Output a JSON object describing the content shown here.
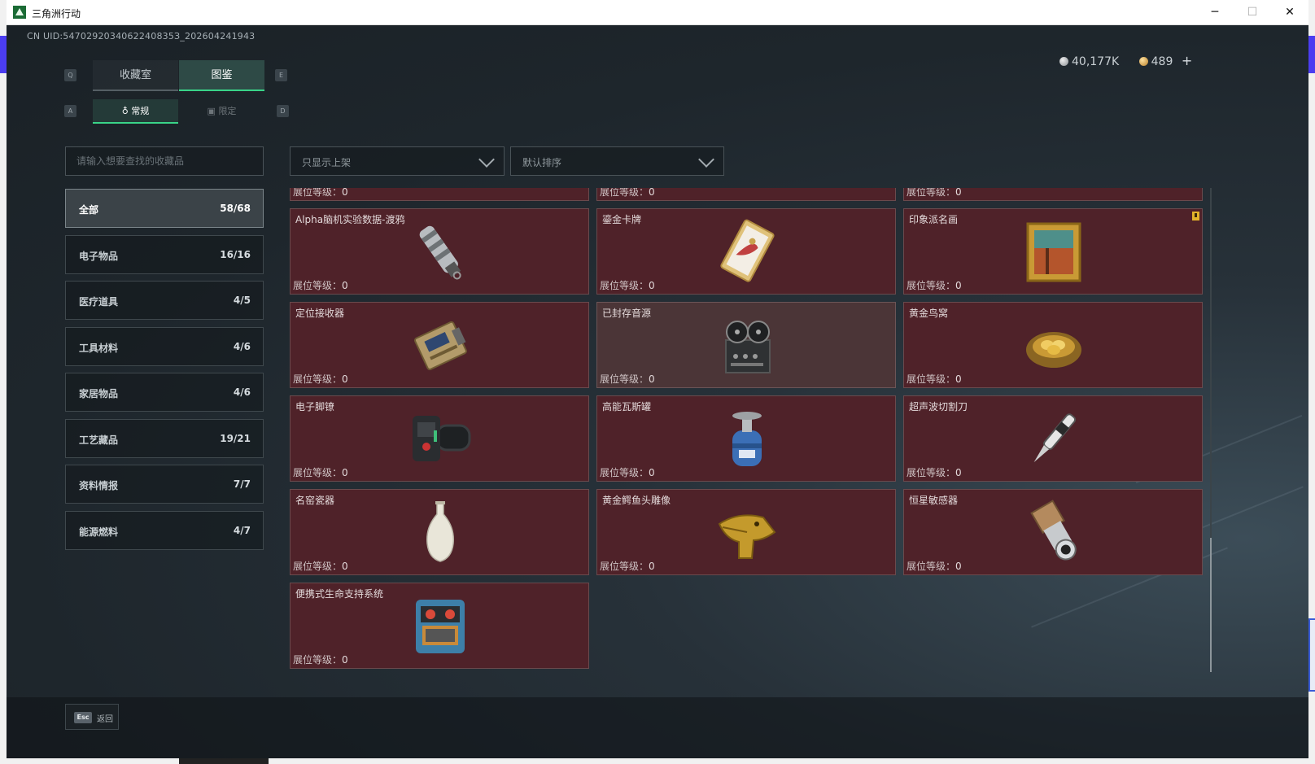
{
  "window": {
    "title": "三角洲行动",
    "minimize": "─",
    "maximize": "☐",
    "close": "✕"
  },
  "uid": "CN UID:5470292034062240835З_202604241943",
  "tabs": {
    "prev_key": "Q",
    "next_key": "E",
    "primary": [
      "收藏室",
      "图鉴"
    ],
    "active_primary": "图鉴",
    "sub_prev_key": "A",
    "sub_next_key": "D",
    "secondary": [
      "常规",
      "限定"
    ],
    "active_secondary": "常规"
  },
  "currency": {
    "coin1": "40,177K",
    "coin2": "489",
    "add": "+"
  },
  "search": {
    "placeholder": "请输入想要查找的收藏品"
  },
  "filters": {
    "filter_label": "只显示上架",
    "sort_label": "默认排序"
  },
  "categories": [
    {
      "name": "全部",
      "count": "58/68",
      "active": true
    },
    {
      "name": "电子物品",
      "count": "16/16"
    },
    {
      "name": "医疗道具",
      "count": "4/5"
    },
    {
      "name": "工具材料",
      "count": "4/6"
    },
    {
      "name": "家居物品",
      "count": "4/6"
    },
    {
      "name": "工艺藏品",
      "count": "19/21"
    },
    {
      "name": "资料情报",
      "count": "7/7"
    },
    {
      "name": "能源燃料",
      "count": "4/7"
    }
  ],
  "level_label": "展位等级：",
  "items": [
    {
      "name": "",
      "level": "0",
      "icon": "partial-item-icon"
    },
    {
      "name": "",
      "level": "0",
      "icon": "partial-item-icon"
    },
    {
      "name": "",
      "level": "0",
      "icon": "partial-item-icon"
    },
    {
      "name": "Alpha脑机实验数据-渡鸦",
      "level": "0",
      "icon": "data-canister-icon"
    },
    {
      "name": "鎏金卡牌",
      "level": "0",
      "icon": "gilded-card-icon"
    },
    {
      "name": "印象派名画",
      "level": "0",
      "icon": "painting-icon",
      "flag": true
    },
    {
      "name": "定位接收器",
      "level": "0",
      "icon": "locator-receiver-icon"
    },
    {
      "name": "已封存音源",
      "level": "0",
      "icon": "reel-recorder-icon",
      "muted": true
    },
    {
      "name": "黄金鸟窝",
      "level": "0",
      "icon": "golden-nest-icon"
    },
    {
      "name": "电子脚镣",
      "level": "0",
      "icon": "ankle-monitor-icon"
    },
    {
      "name": "高能瓦斯罐",
      "level": "0",
      "icon": "gas-canister-icon"
    },
    {
      "name": "超声波切割刀",
      "level": "0",
      "icon": "ultrasonic-cutter-icon"
    },
    {
      "name": "名窑瓷器",
      "level": "0",
      "icon": "porcelain-vase-icon"
    },
    {
      "name": "黄金鳄鱼头雕像",
      "level": "0",
      "icon": "golden-crocodile-icon"
    },
    {
      "name": "恒星敏感器",
      "level": "0",
      "icon": "star-sensor-icon"
    },
    {
      "name": "便携式生命支持系统",
      "level": "0",
      "icon": "life-support-icon"
    }
  ],
  "footer": {
    "esc_key": "Esc",
    "back_label": "返回"
  },
  "colors": {
    "accent": "#39d488",
    "card_bg": "#4f2229",
    "flag": "#e3b42a"
  }
}
